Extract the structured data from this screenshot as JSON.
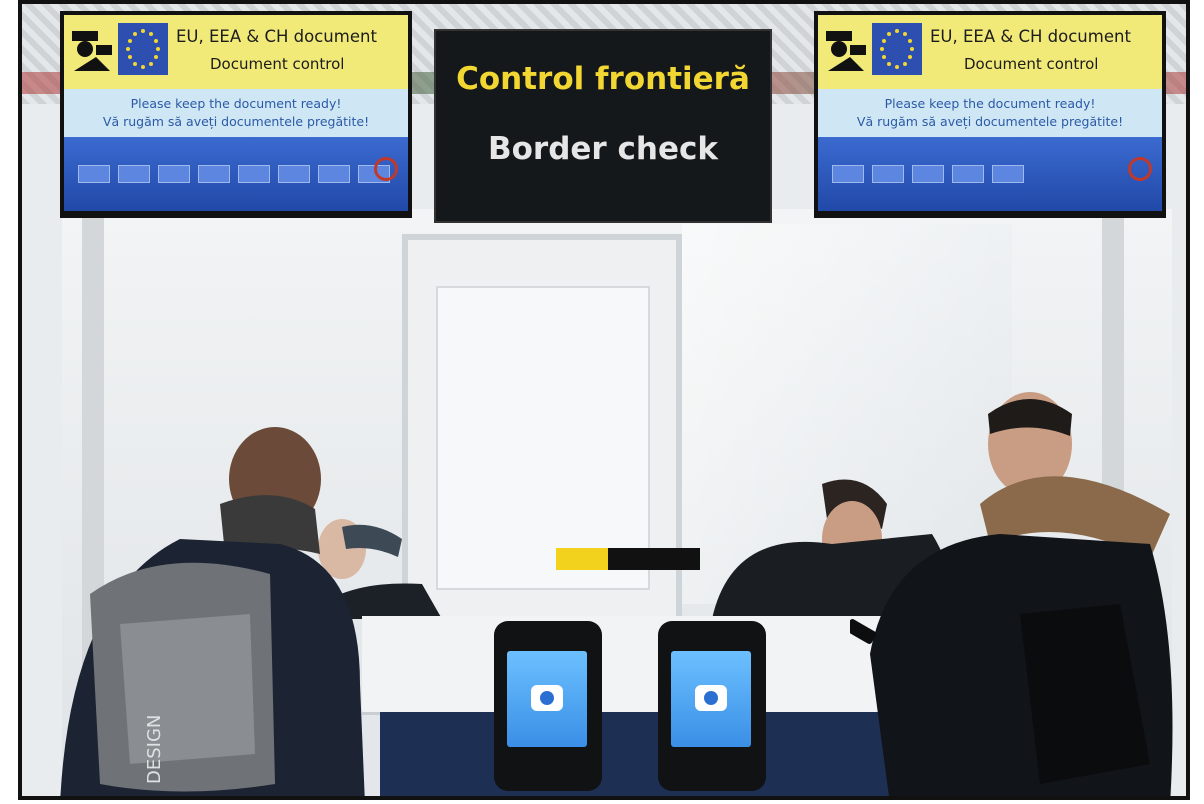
{
  "sign": {
    "title_ro": "Control frontieră",
    "title_en": "Border check"
  },
  "monitor_left": {
    "line1": "EU, EEA & CH document",
    "line2": "Document control",
    "msg_en": "Please keep the document ready!",
    "msg_ro": "Vă rugăm să aveți documentele pregătite!"
  },
  "monitor_right": {
    "line1": "EU, EEA & CH document",
    "line2": "Document control",
    "msg_en": "Please keep the document ready!",
    "msg_ro": "Vă rugăm să aveți documentele pregătite!"
  },
  "backpack": {
    "brand": "DESIGN"
  },
  "colors": {
    "sign_bg": "#15181b",
    "sign_yellow": "#f2d631",
    "monitor_header": "#f1ea78",
    "monitor_bar": "#2149a8",
    "scanner_screen": "#3a8fe6"
  }
}
